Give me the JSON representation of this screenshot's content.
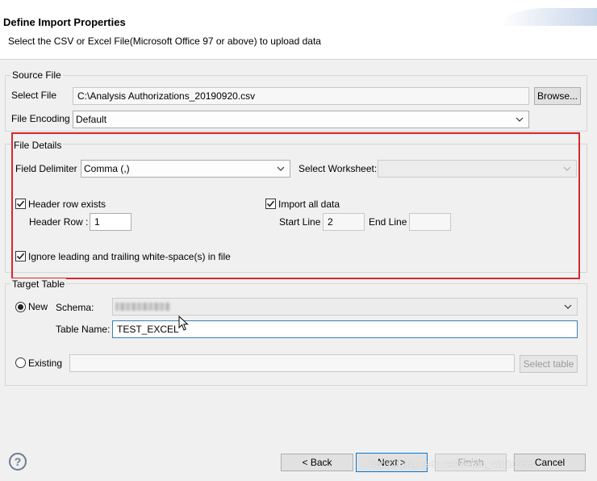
{
  "header": {
    "title": "Define Import Properties",
    "subtitle": "Select the CSV or Excel File(Microsoft Office 97 or above) to upload data"
  },
  "source_file": {
    "legend": "Source File",
    "select_file_label": "Select File",
    "select_file_value": "C:\\Analysis Authorizations_20190920.csv",
    "browse_label": "Browse...",
    "encoding_label": "File Encoding",
    "encoding_value": "Default"
  },
  "file_details": {
    "legend": "File Details",
    "delimiter_label": "Field Delimiter",
    "delimiter_value": "Comma (,)",
    "worksheet_label": "Select Worksheet:",
    "worksheet_value": "",
    "header_row_exists_label": "Header row exists",
    "header_row_exists_checked": true,
    "header_row_label": "Header Row :",
    "header_row_value": "1",
    "import_all_label": "Import all data",
    "import_all_checked": true,
    "start_line_label": "Start Line",
    "start_line_value": "2",
    "end_line_label": "End Line",
    "end_line_value": "",
    "ignore_whitespace_label": "Ignore leading and trailing white-space(s) in file",
    "ignore_whitespace_checked": true
  },
  "target_table": {
    "legend": "Target Table",
    "new_label": "New",
    "new_selected": true,
    "schema_label": "Schema:",
    "schema_value": "",
    "table_name_label": "Table Name:",
    "table_name_value": "TEST_EXCEL",
    "existing_label": "Existing",
    "existing_selected": false,
    "existing_value": "",
    "select_table_label": "Select table"
  },
  "footer": {
    "back_label": "< Back",
    "next_label": "Next >",
    "finish_label": "Finish",
    "cancel_label": "Cancel",
    "watermark": "https://blog.csdn.net/weixin_42110053"
  },
  "colors": {
    "highlight_border": "#d6282b",
    "focus_border": "#3c7fb1",
    "default_button_border": "#0078d7"
  },
  "icons": {
    "help": "help-question-icon",
    "dropdown": "chevron-down-icon",
    "check": "check-icon",
    "cursor": "mouse-pointer-icon"
  }
}
